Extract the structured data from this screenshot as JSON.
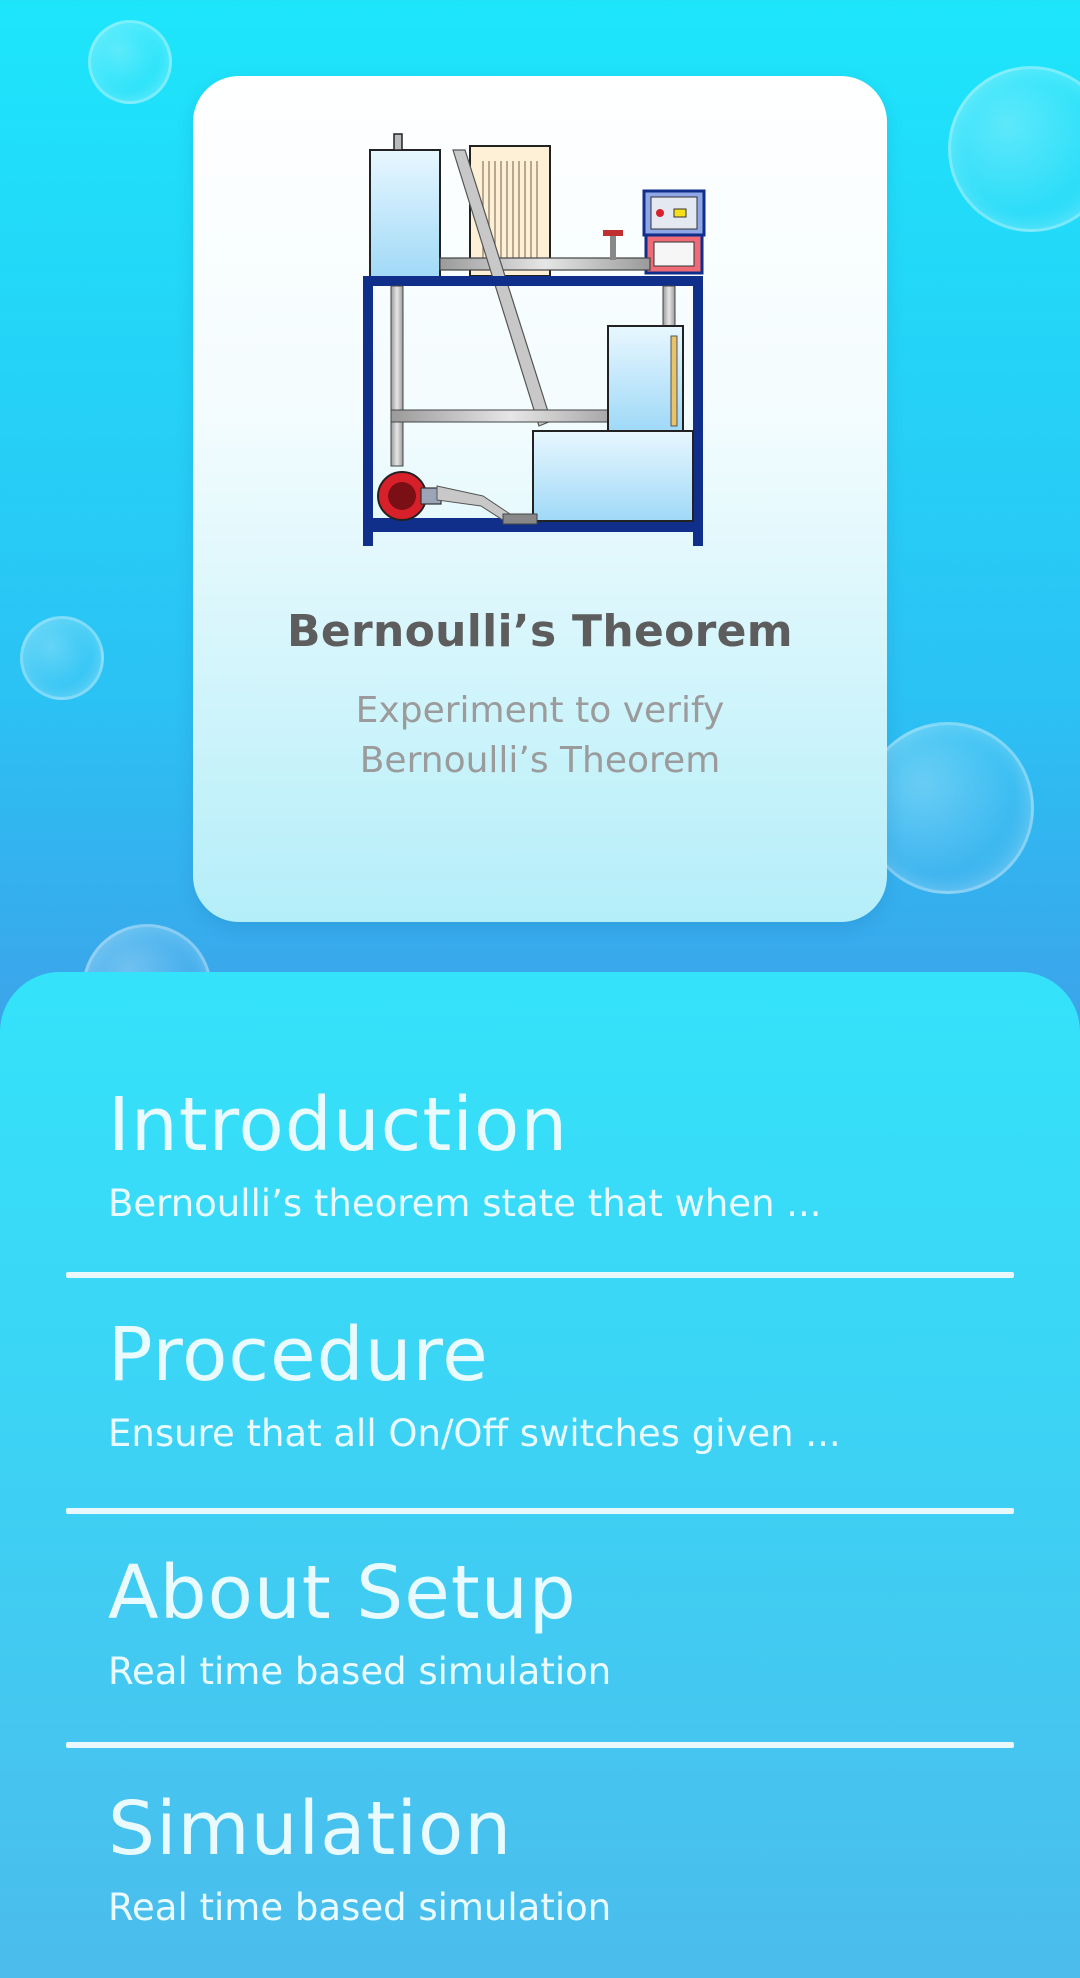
{
  "card": {
    "image_icon": "bernoulli-apparatus-illustration",
    "title": "Bernoulli’s Theorem",
    "subtitle_line1": "Experiment to verify",
    "subtitle_line2": "Bernoulli’s Theorem"
  },
  "menu": {
    "items": [
      {
        "title": "Introduction",
        "description": "Bernoulli’s theorem state that when ..."
      },
      {
        "title": "Procedure",
        "description": "Ensure that all On/Off switches given ..."
      },
      {
        "title": "About Setup",
        "description": "Real time based simulation"
      },
      {
        "title": "Simulation",
        "description": "Real time based simulation"
      }
    ]
  },
  "colors": {
    "card_title": "#5d5d5d",
    "card_subtitle": "#9b9b9b",
    "menu_text": "#e9fbff",
    "frame_blue": "#0f2f8a",
    "pump_red": "#d8202a"
  }
}
